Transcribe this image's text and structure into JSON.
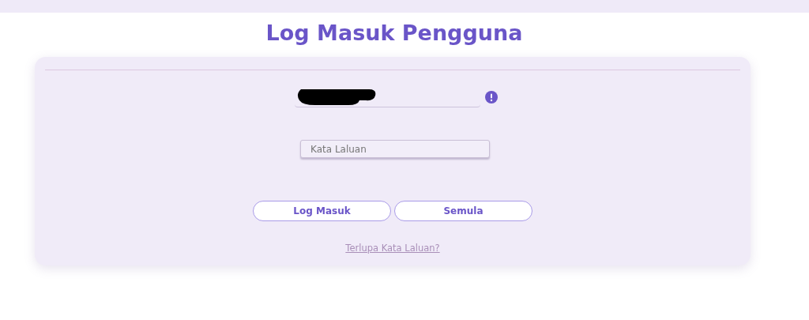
{
  "title": "Log Masuk Pengguna",
  "username": {
    "redacted": true,
    "invalid": true
  },
  "password": {
    "placeholder": "Kata Laluan"
  },
  "buttons": [
    {
      "label": "Log Masuk"
    },
    {
      "label": "Semula"
    }
  ],
  "forgot_link": "Terlupa Kata Laluan?"
}
